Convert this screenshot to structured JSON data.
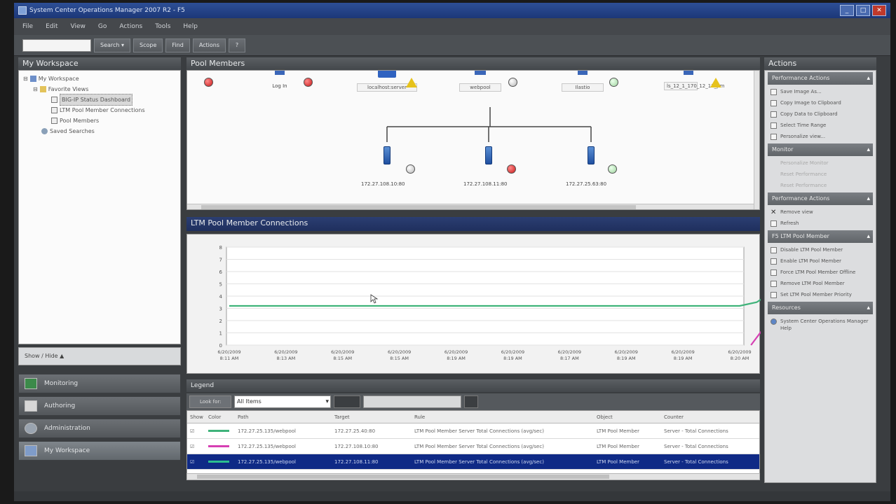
{
  "window": {
    "title": "System Center Operations Manager 2007 R2 - F5",
    "buttons": [
      "_",
      "□",
      "✕"
    ]
  },
  "menu": [
    "File",
    "Edit",
    "View",
    "Go",
    "Actions",
    "Tools",
    "Help"
  ],
  "toolbar": {
    "search_placeholder": "",
    "buttons": [
      "Search ▾",
      "Scope",
      "Find",
      "Actions"
    ]
  },
  "workspace": {
    "header": "My Workspace",
    "tree": [
      {
        "label": "My Workspace",
        "indent": 0
      },
      {
        "label": "Favorite Views",
        "indent": 1
      },
      {
        "label": "BIG-IP Status Dashboard",
        "indent": 2,
        "selected": true
      },
      {
        "label": "LTM Pool Member Connections",
        "indent": 2
      },
      {
        "label": "Pool Members",
        "indent": 2
      },
      {
        "label": "Saved Searches",
        "indent": 1
      }
    ],
    "show_hide": "Show / Hide ▲",
    "wunderbar": [
      "Monitoring",
      "Authoring",
      "Administration",
      "My Workspace"
    ]
  },
  "pool_members": {
    "header": "Pool Members",
    "top_nodes": [
      "Log In",
      "localhost:server",
      "webpool",
      "Ilastio",
      "ls_12_1_170_12_11_pm"
    ],
    "members": [
      "172.27.108.10:80",
      "172.27.108.11:80",
      "172.27.25.63:80"
    ]
  },
  "connections_chart": {
    "header": "LTM Pool Member Connections"
  },
  "chart_data": {
    "type": "line",
    "title": "",
    "xlabel": "",
    "ylabel": "",
    "ylim": [
      0,
      8
    ],
    "y_ticks": [
      "0",
      "1",
      "2",
      "3",
      "4",
      "5",
      "6",
      "7",
      "8"
    ],
    "x_tick_labels": [
      "6/20/2009 8:11 AM",
      "6/20/2009 8:13 AM",
      "6/20/2009 8:15 AM",
      "6/20/2009 8:15 AM",
      "6/20/2009 8:19 AM",
      "6/20/2009 8:19 AM",
      "6/20/2009 8:17 AM",
      "6/20/2009 8:19 AM",
      "6/20/2009 8:19 AM",
      "6/20/2009 8:20 AM"
    ],
    "x": [
      0,
      9.3,
      9.6
    ],
    "grid": true,
    "legend": "none",
    "series": [
      {
        "color": "#3fb37a",
        "x": [
          0,
          1,
          2,
          3,
          4,
          5,
          6,
          7,
          8,
          9,
          9.3,
          9.6
        ],
        "values": [
          3.2,
          3.2,
          3.2,
          3.2,
          3.2,
          3.2,
          3.2,
          3.2,
          3.2,
          3.2,
          3.5,
          4.4
        ]
      },
      {
        "color": "#d63fb3",
        "x": [
          9.2,
          9.8
        ],
        "values": [
          0,
          3.7
        ]
      }
    ]
  },
  "legend_grid": {
    "header": "Legend",
    "filter_button": "Look for:",
    "filter_value": "All Items",
    "columns": [
      "Show",
      "Color",
      "Path",
      "Target",
      "Rule",
      "Object",
      "Counter"
    ],
    "rows": [
      {
        "color": "#3fb37a",
        "path": "172.27.25.135/webpool",
        "target": "172.27.25.40:80",
        "rule": "LTM Pool Member Server Total Connections (avg/sec)",
        "object": "LTM Pool Member",
        "counter": "Server - Total Connections"
      },
      {
        "color": "#d63fb3",
        "path": "172.27.25.135/webpool",
        "target": "172.27.108.10:80",
        "rule": "LTM Pool Member Server Total Connections (avg/sec)",
        "object": "LTM Pool Member",
        "counter": "Server - Total Connections"
      },
      {
        "color": "#2bbf8f",
        "path": "172.27.25.135/webpool",
        "target": "172.27.108.11:80",
        "rule": "LTM Pool Member Server Total Connections (avg/sec)",
        "object": "LTM Pool Member",
        "counter": "Server - Total Connections",
        "selected": true
      }
    ]
  },
  "actions": {
    "header": "Actions",
    "sections": [
      {
        "title": "Performance Actions",
        "items": [
          {
            "label": "Save Image As..."
          },
          {
            "label": "Copy Image to Clipboard"
          },
          {
            "label": "Copy Data to Clipboard"
          },
          {
            "label": "Select Time Range"
          },
          {
            "label": "Personalize view..."
          }
        ]
      },
      {
        "title": "Monitor",
        "items": [
          {
            "label": "Personalize Monitor",
            "disabled": true
          },
          {
            "label": "Reset Performance",
            "disabled": true
          },
          {
            "label": "Reset Performance",
            "disabled": true
          }
        ]
      },
      {
        "title": "Performance Actions",
        "items": [
          {
            "label": "Remove view"
          },
          {
            "label": "Refresh"
          }
        ]
      },
      {
        "title": "F5 LTM Pool Member",
        "items": [
          {
            "label": "Disable LTM Pool Member"
          },
          {
            "label": "Enable LTM Pool Member"
          },
          {
            "label": "Force LTM Pool Member Offline"
          },
          {
            "label": "Remove LTM Pool Member"
          },
          {
            "label": "Set LTM Pool Member Priority"
          }
        ]
      },
      {
        "title": "Resources",
        "items": [
          {
            "label": "System Center Operations Manager Help"
          }
        ]
      }
    ]
  }
}
